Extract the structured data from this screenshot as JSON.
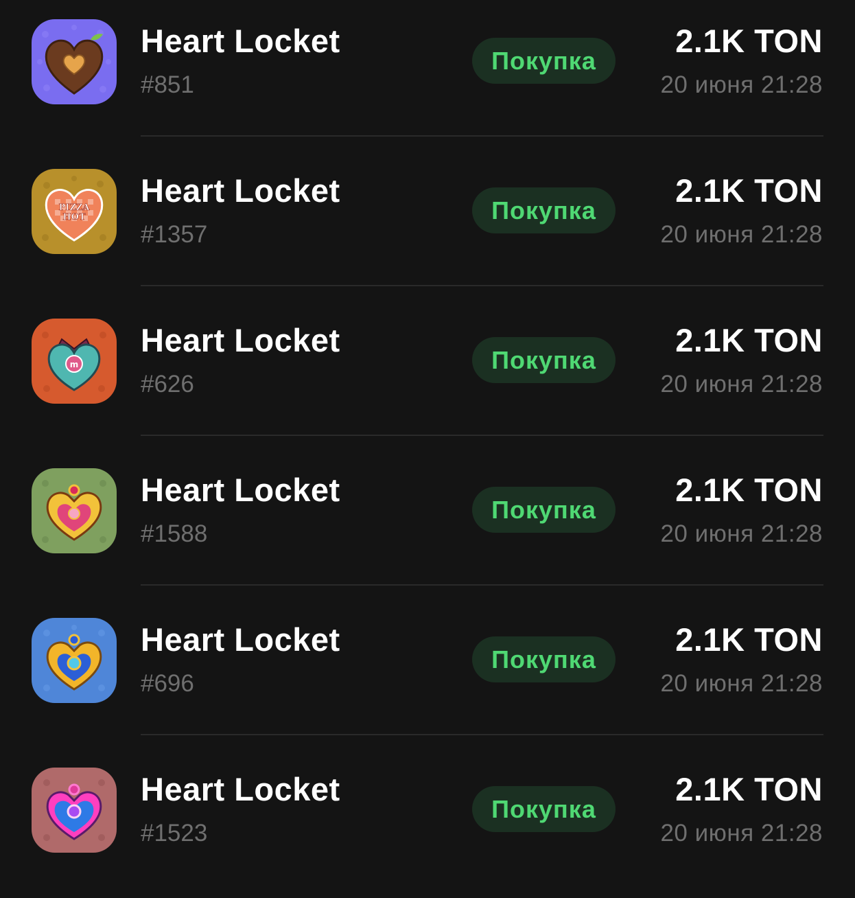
{
  "transactions": [
    {
      "title": "Heart Locket",
      "number": "#851",
      "badge": "Покупка",
      "price": "2.1K TON",
      "date": "20 июня 21:28",
      "icon_color": "#7a6df0",
      "icon_name": "wooden-heart-locket-icon"
    },
    {
      "title": "Heart Locket",
      "number": "#1357",
      "badge": "Покупка",
      "price": "2.1K TON",
      "date": "20 июня 21:28",
      "icon_color": "#b8902b",
      "icon_name": "pizza-heart-locket-icon",
      "icon_text_1": "PIZZA",
      "icon_text_2": "HOT"
    },
    {
      "title": "Heart Locket",
      "number": "#626",
      "badge": "Покупка",
      "price": "2.1K TON",
      "date": "20 июня 21:28",
      "icon_color": "#d65a2e",
      "icon_name": "teal-heart-locket-icon"
    },
    {
      "title": "Heart Locket",
      "number": "#1588",
      "badge": "Покупка",
      "price": "2.1K TON",
      "date": "20 июня 21:28",
      "icon_color": "#7fa05f",
      "icon_name": "pink-gold-heart-locket-icon"
    },
    {
      "title": "Heart Locket",
      "number": "#696",
      "badge": "Покупка",
      "price": "2.1K TON",
      "date": "20 июня 21:28",
      "icon_color": "#4f86d8",
      "icon_name": "blue-gold-heart-locket-icon"
    },
    {
      "title": "Heart Locket",
      "number": "#1523",
      "badge": "Покупка",
      "price": "2.1K TON",
      "date": "20 июня 21:28",
      "icon_color": "#b06a6a",
      "icon_name": "neon-heart-locket-icon"
    }
  ],
  "colors": {
    "background": "#141414",
    "badge_bg": "#1b3022",
    "badge_text": "#4fd873",
    "secondary_text": "#6f6f6f",
    "divider": "#2a2a2a"
  }
}
